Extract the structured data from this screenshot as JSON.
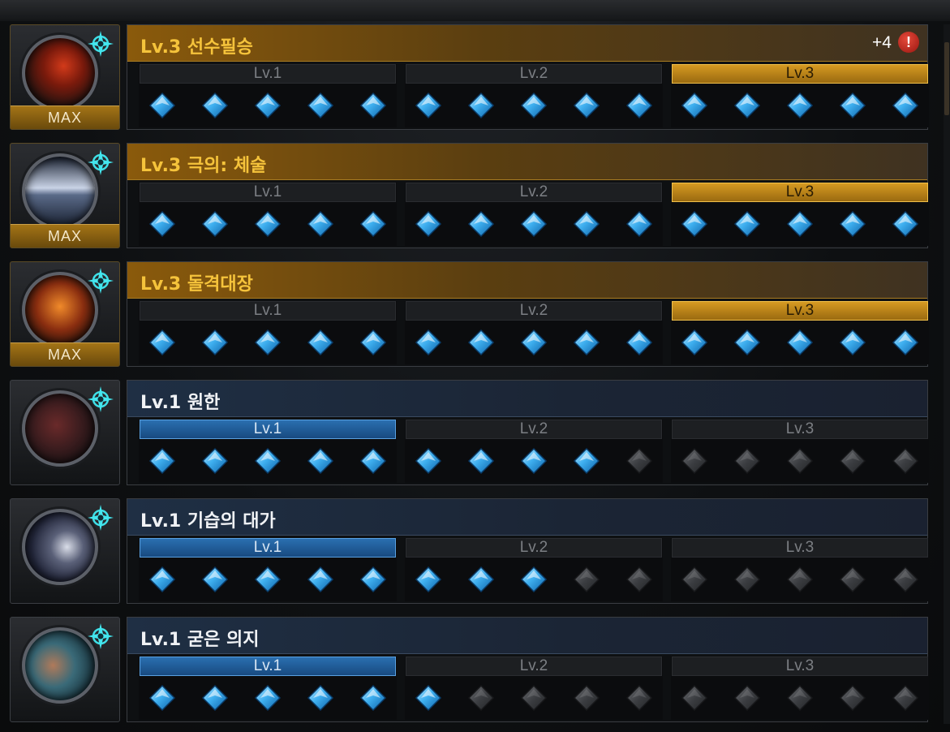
{
  "tier_labels": {
    "t1": "Lv.1",
    "t2": "Lv.2",
    "t3": "Lv.3"
  },
  "max_label": "MAX",
  "colors": {
    "gold": "#f5c33b",
    "gem_active": "#3fb0f0",
    "gem_inactive": "#4a4c50"
  },
  "skills": [
    {
      "title": "Lv.3 선수필승",
      "level": 3,
      "max": true,
      "theme": "gold",
      "bonus": "+4",
      "alert": "!",
      "gems_active": [
        5,
        5,
        5
      ],
      "icon": "warrior-slash-icon"
    },
    {
      "title": "Lv.3 극의: 체술",
      "level": 3,
      "max": true,
      "theme": "gold",
      "gems_active": [
        5,
        5,
        5
      ],
      "icon": "punch-strike-icon"
    },
    {
      "title": "Lv.3 돌격대장",
      "level": 3,
      "max": true,
      "theme": "gold",
      "gems_active": [
        5,
        5,
        5
      ],
      "icon": "charging-crowd-icon"
    },
    {
      "title": "Lv.1 원한",
      "level": 1,
      "max": false,
      "theme": "blue",
      "gems_active": [
        5,
        4,
        0
      ],
      "icon": "grudge-demon-icon"
    },
    {
      "title": "Lv.1 기습의 대가",
      "level": 1,
      "max": false,
      "theme": "blue",
      "gems_active": [
        5,
        3,
        0
      ],
      "icon": "shadow-ambush-icon"
    },
    {
      "title": "Lv.1 굳은 의지",
      "level": 1,
      "max": false,
      "theme": "blue",
      "gems_active": [
        5,
        1,
        0
      ],
      "icon": "strong-will-fighter-icon"
    }
  ]
}
